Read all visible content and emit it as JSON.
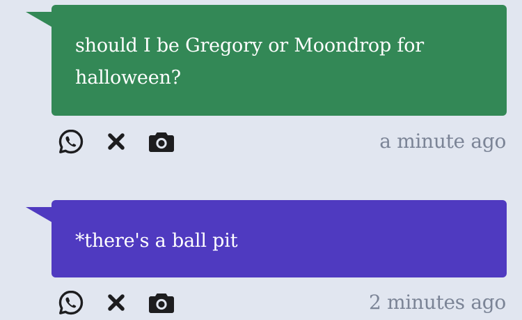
{
  "messages": [
    {
      "text": "should I be Gregory or Moondrop for halloween?",
      "timestamp": "a minute ago",
      "color": "#338856",
      "actions": [
        "whatsapp-icon",
        "close-icon",
        "camera-icon"
      ]
    },
    {
      "text": "*there's a ball pit",
      "timestamp": "2 minutes ago",
      "color": "#4f3ac0",
      "actions": [
        "whatsapp-icon",
        "close-icon",
        "camera-icon"
      ]
    }
  ],
  "colors": {
    "background": "#e1e6f0",
    "icon": "#1d1d1f",
    "timestamp": "#7b8496"
  }
}
